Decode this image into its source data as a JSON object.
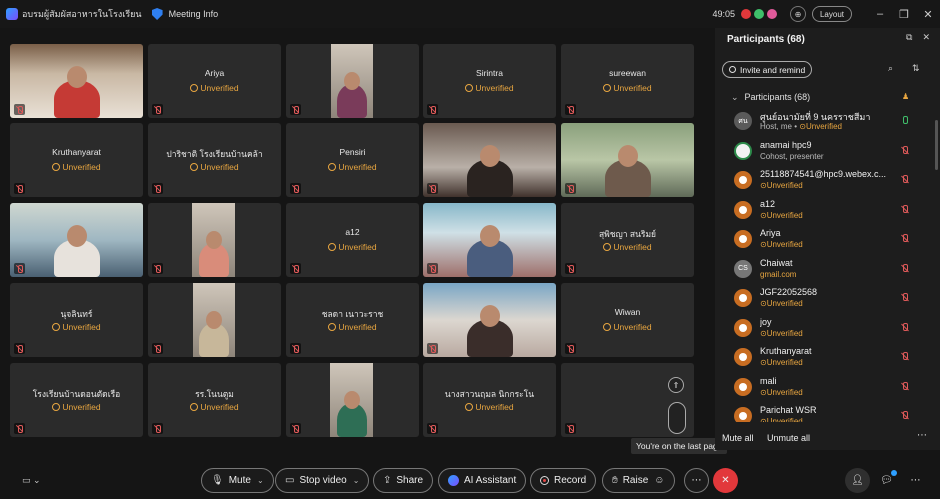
{
  "titlebar": {
    "app_title": "อบรมผู้สัมผัสอาหารในโรงเรียน",
    "meeting_info": "Meeting Info",
    "timer": "49:05",
    "layout_label": "Layout",
    "status_colors": [
      "#e2383b",
      "#3fbf6a",
      "#e05a9a"
    ]
  },
  "grid": {
    "tiles": [
      {
        "name": "",
        "status": ""
      },
      {
        "name": "Ariya",
        "status": "Unverified"
      },
      {
        "name": "",
        "status": ""
      },
      {
        "name": "Sirintra",
        "status": "Unverified"
      },
      {
        "name": "sureewan",
        "status": "Unverified"
      },
      {
        "name": "Kruthanyarat",
        "status": "Unverified"
      },
      {
        "name": "ปาริชาติ โรงเรียนบ้านคล้า",
        "status": "Unverified"
      },
      {
        "name": "Pensiri",
        "status": "Unverified"
      },
      {
        "name": "",
        "status": ""
      },
      {
        "name": "",
        "status": ""
      },
      {
        "name": "",
        "status": ""
      },
      {
        "name": "",
        "status": ""
      },
      {
        "name": "a12",
        "status": "Unverified"
      },
      {
        "name": "",
        "status": ""
      },
      {
        "name": "สุพิชญา สนริมย์",
        "status": "Unverified"
      },
      {
        "name": "นุจลินทร์",
        "status": "Unverified"
      },
      {
        "name": "",
        "status": ""
      },
      {
        "name": "ชลดา เนาวะราช",
        "status": "Unverified"
      },
      {
        "name": "",
        "status": ""
      },
      {
        "name": "Wiwan",
        "status": "Unverified"
      },
      {
        "name": "โรงเรียนบ้านดอนตัดเรือ",
        "status": "Unverified"
      },
      {
        "name": "รร.โนนตูม",
        "status": "Unverified"
      },
      {
        "name": "",
        "status": ""
      },
      {
        "name": "นางสาวนฤมล นิกกระโน",
        "status": "Unverified"
      }
    ],
    "tooltip": "You're on the last page"
  },
  "panel": {
    "title": "Participants (68)",
    "invite_label": "Invite and remind",
    "section_label": "Participants (68)",
    "participants": [
      {
        "name": "ศูนย์อนามัยที่ 9 นครราชสีมา",
        "sub": "Host, me • ",
        "unverified": "Unverified",
        "avatar": "ศน",
        "mic": "on"
      },
      {
        "name": "anamai hpc9",
        "sub": "Cohost, presenter",
        "unverified": "",
        "avatar": "",
        "mic": "off"
      },
      {
        "name": "25118874541@hpc9.webex.c...",
        "sub": "",
        "unverified": "Unverified",
        "avatar": "",
        "mic": "off"
      },
      {
        "name": "a12",
        "sub": "",
        "unverified": "Unverified",
        "avatar": "",
        "mic": "off"
      },
      {
        "name": "Ariya",
        "sub": "",
        "unverified": "Unverified",
        "avatar": "",
        "mic": "off"
      },
      {
        "name": "Chaiwat",
        "sub": "",
        "unverified": "gmail.com",
        "avatar": "CS",
        "mic": "off"
      },
      {
        "name": "JGF22052568",
        "sub": "",
        "unverified": "Unverified",
        "avatar": "",
        "mic": "off"
      },
      {
        "name": "joy",
        "sub": "",
        "unverified": "Unverified",
        "avatar": "",
        "mic": "off"
      },
      {
        "name": "Kruthanyarat",
        "sub": "",
        "unverified": "Unverified",
        "avatar": "",
        "mic": "off"
      },
      {
        "name": "mali",
        "sub": "",
        "unverified": "Unverified",
        "avatar": "",
        "mic": "off"
      },
      {
        "name": "Parichat WSR",
        "sub": "",
        "unverified": "Unverified",
        "avatar": "",
        "mic": "off"
      }
    ],
    "mute_all": "Mute all",
    "unmute_all": "Unmute all"
  },
  "toolbar": {
    "mute": "Mute",
    "stop_video": "Stop video",
    "share": "Share",
    "ai_assistant": "AI Assistant",
    "record": "Record",
    "raise": "Raise"
  }
}
